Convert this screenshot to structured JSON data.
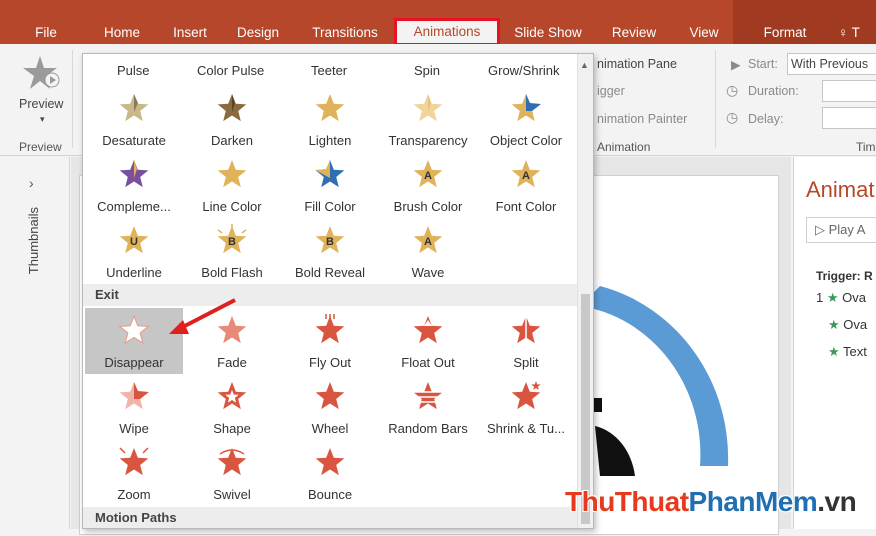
{
  "colors": {
    "accent": "#b7472a",
    "highlight_box": "#e81123",
    "emphasis_star": "#e0b25a",
    "exit_star": "#d9553f",
    "arrow": "#e02020",
    "pane_star": "#3a9a5b"
  },
  "tabs": [
    "File",
    "Home",
    "Insert",
    "Design",
    "Transitions",
    "Animations",
    "Slide Show",
    "Review",
    "View",
    "Format"
  ],
  "tell_me_glyph": "♀ T",
  "ribbon": {
    "preview_label": "Preview",
    "preview_group": "Preview",
    "animation_pane": "nimation Pane",
    "trigger": "igger",
    "animation_painter": "nimation Painter",
    "animation_group": "Animation",
    "start_label": "Start:",
    "start_value": "With Previous",
    "duration_label": "Duration:",
    "delay_label": "Delay:",
    "timing_group": "Tim"
  },
  "thumbnails": {
    "chevron": "›",
    "label": "Thumbnails"
  },
  "gallery": {
    "top_labels": [
      "Pulse",
      "Color Pulse",
      "Teeter",
      "Spin",
      "Grow/Shrink"
    ],
    "emphasis_rows": [
      [
        {
          "label": "Desaturate",
          "icon": "desaturate-star-icon"
        },
        {
          "label": "Darken",
          "icon": "darken-star-icon"
        },
        {
          "label": "Lighten",
          "icon": "lighten-star-icon"
        },
        {
          "label": "Transparency",
          "icon": "transparency-star-icon"
        },
        {
          "label": "Object Color",
          "icon": "object-color-star-icon"
        }
      ],
      [
        {
          "label": "Compleme...",
          "icon": "complementary-star-icon"
        },
        {
          "label": "Line Color",
          "icon": "line-color-star-icon"
        },
        {
          "label": "Fill Color",
          "icon": "fill-color-star-icon"
        },
        {
          "label": "Brush Color",
          "icon": "brush-color-star-icon"
        },
        {
          "label": "Font Color",
          "icon": "font-color-star-icon"
        }
      ],
      [
        {
          "label": "Underline",
          "icon": "underline-star-icon"
        },
        {
          "label": "Bold Flash",
          "icon": "bold-flash-star-icon"
        },
        {
          "label": "Bold Reveal",
          "icon": "bold-reveal-star-icon"
        },
        {
          "label": "Wave",
          "icon": "wave-star-icon"
        }
      ]
    ],
    "exit_header": "Exit",
    "exit_rows": [
      [
        {
          "label": "Disappear",
          "icon": "disappear-star-icon"
        },
        {
          "label": "Fade",
          "icon": "fade-star-icon"
        },
        {
          "label": "Fly Out",
          "icon": "fly-out-star-icon"
        },
        {
          "label": "Float Out",
          "icon": "float-out-star-icon"
        },
        {
          "label": "Split",
          "icon": "split-star-icon"
        }
      ],
      [
        {
          "label": "Wipe",
          "icon": "wipe-star-icon"
        },
        {
          "label": "Shape",
          "icon": "shape-star-icon"
        },
        {
          "label": "Wheel",
          "icon": "wheel-star-icon"
        },
        {
          "label": "Random Bars",
          "icon": "random-bars-star-icon"
        },
        {
          "label": "Shrink & Tu...",
          "icon": "shrink-turn-star-icon"
        }
      ],
      [
        {
          "label": "Zoom",
          "icon": "zoom-star-icon"
        },
        {
          "label": "Swivel",
          "icon": "swivel-star-icon"
        },
        {
          "label": "Bounce",
          "icon": "bounce-star-icon"
        }
      ]
    ],
    "motion_header": "Motion Paths",
    "letters": {
      "brush": "A",
      "font": "A",
      "underline": "U",
      "bold_flash": "B",
      "bold_reveal": "B",
      "wave": "A"
    }
  },
  "anim_pane": {
    "title": "Animat",
    "play": "▷ Play A",
    "trigger": "Trigger: R",
    "rows": [
      {
        "num": "1",
        "text": "Ova"
      },
      {
        "num": "",
        "text": "Ova"
      },
      {
        "num": "",
        "text": "Text"
      }
    ]
  },
  "watermark": {
    "part1": "ThuThuat",
    "part2": "PhanMem",
    "part3": ".vn"
  }
}
